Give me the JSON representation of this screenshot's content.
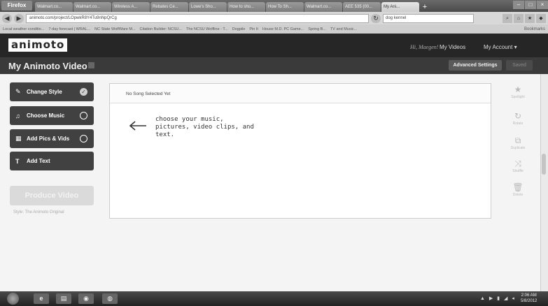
{
  "browser": {
    "app_button": "Firefox",
    "tabs": [
      "Walmart.co...",
      "Walmart.co...",
      "Wireless A...",
      "Rebates Ce...",
      "Lowe's Sho...",
      "How to sho...",
      "How To Sh...",
      "Walmart.co...",
      "AEE 535 (00...",
      "My Ani..."
    ],
    "active_tab_index": 9,
    "new_tab": "+",
    "url": "animoto.com/project/LOpwkR8Y4Tu9nNpQrCg",
    "search": "dog kennel",
    "bookmarks": [
      "Local weather conditio...",
      "7-day forecast | WRAL...",
      "NC State WolfWare M...",
      "Citation Builder: NCSU...",
      "The NCSU Wolfline - T...",
      "Dogpile",
      "Pin It",
      "House M.D. PC Game...",
      "Spring B...",
      "TV and Music..."
    ],
    "bookmarks_label": "Bookmarks"
  },
  "site": {
    "logo": "animoto",
    "greeting": "Hi, Maegen!",
    "nav": [
      "My Videos",
      "My Account ▾"
    ],
    "page_title": "My Animoto Video",
    "advanced_settings": "Advanced Settings",
    "saved": "Saved"
  },
  "sidebar": {
    "steps": [
      {
        "label": "Change Style",
        "icon": "✓"
      },
      {
        "label": "Choose Music",
        "icon": "♫"
      },
      {
        "label": "Add Pics & Vids",
        "icon": "▦"
      },
      {
        "label": "Add Text",
        "icon": "T"
      }
    ],
    "produce": "Produce Video",
    "style_note": "Style: The Animoto Original"
  },
  "editor": {
    "song": "No Song Selected Yet",
    "hint": "choose your music, pictures, video clips, and text."
  },
  "tools": [
    {
      "icon": "★",
      "label": "Spotlight"
    },
    {
      "icon": "↻",
      "label": "Rotate"
    },
    {
      "icon": "⧉",
      "label": "Duplicate"
    },
    {
      "icon": "⤨",
      "label": "Shuffle"
    },
    {
      "icon": "🗑",
      "label": "Delete"
    }
  ],
  "taskbar": {
    "tray": "▲ ▶ ▮ ◢ ◂",
    "time": "2:06 AM",
    "date": "5/8/2012"
  },
  "colors": {
    "header": "#262626",
    "button": "#414141",
    "panel": "#ffffff"
  }
}
